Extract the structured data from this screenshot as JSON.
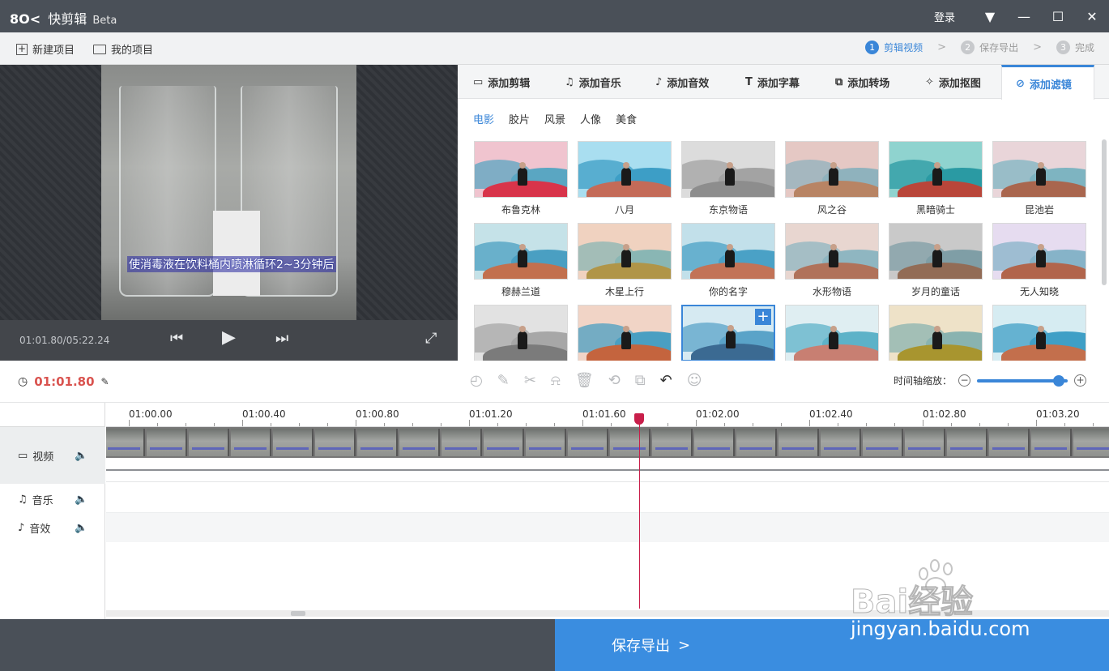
{
  "titlebar": {
    "logo": "快剪辑",
    "beta": "Beta",
    "login": "登录"
  },
  "toolbar": {
    "new_project": "新建项目",
    "my_projects": "我的项目",
    "steps": [
      {
        "num": "1",
        "label": "剪辑视频",
        "active": true
      },
      {
        "num": "2",
        "label": "保存导出",
        "active": false
      },
      {
        "num": "3",
        "label": "完成",
        "active": false
      }
    ]
  },
  "preview": {
    "subtitle": "使消毒液在饮料桶内喷淋循环2~3分钟后",
    "timecode": "01:01.80/05:22.24"
  },
  "panel": {
    "tabs": [
      {
        "label": "添加剪辑",
        "icon": "video-icon"
      },
      {
        "label": "添加音乐",
        "icon": "music-icon"
      },
      {
        "label": "添加音效",
        "icon": "sound-effect-icon"
      },
      {
        "label": "添加字幕",
        "icon": "text-icon"
      },
      {
        "label": "添加转场",
        "icon": "transition-icon"
      },
      {
        "label": "添加抠图",
        "icon": "cutout-icon"
      },
      {
        "label": "添加滤镜",
        "icon": "filter-icon",
        "active": true
      }
    ],
    "categories": [
      {
        "label": "电影",
        "active": true
      },
      {
        "label": "胶片",
        "active": false
      },
      {
        "label": "风景",
        "active": false
      },
      {
        "label": "人像",
        "active": false
      },
      {
        "label": "美食",
        "active": false
      }
    ],
    "filters": [
      {
        "label": "布鲁克林",
        "sky": "#f0c4cf",
        "rock": "#d8344a",
        "mtn": "#5aa6c2"
      },
      {
        "label": "八月",
        "sky": "#a9def0",
        "rock": "#c46b58",
        "mtn": "#3d9ec6"
      },
      {
        "label": "东京物语",
        "sky": "#dcdcdc",
        "rock": "#8d8d8d",
        "mtn": "#a3a3a3"
      },
      {
        "label": "风之谷",
        "sky": "#e5c8c4",
        "rock": "#b88464",
        "mtn": "#8fb2bd"
      },
      {
        "label": "黑暗骑士",
        "sky": "#8fd3cf",
        "rock": "#b9463a",
        "mtn": "#2a9aa3"
      },
      {
        "label": "昆池岩",
        "sky": "#e9d5d9",
        "rock": "#a9664e",
        "mtn": "#7eb4c1"
      },
      {
        "label": "穆赫兰道",
        "sky": "#c5e2e8",
        "rock": "#c2704e",
        "mtn": "#4a9fc2"
      },
      {
        "label": "木星上行",
        "sky": "#f0d2c0",
        "rock": "#b09548",
        "mtn": "#89b6b4"
      },
      {
        "label": "你的名字",
        "sky": "#c2e0ea",
        "rock": "#c27357",
        "mtn": "#4aa1c6"
      },
      {
        "label": "水形物语",
        "sky": "#e8d6d0",
        "rock": "#b0725a",
        "mtn": "#8fb6c1"
      },
      {
        "label": "岁月的童话",
        "sky": "#c9c9c9",
        "rock": "#926c56",
        "mtn": "#7f9ea6"
      },
      {
        "label": "无人知晓",
        "sky": "#e6dcf0",
        "rock": "#b1654c",
        "mtn": "#86b3c8"
      },
      {
        "label": "",
        "sky": "#e2e2e2",
        "rock": "#7b7b7b",
        "mtn": "#a7a7a7"
      },
      {
        "label": "",
        "sky": "#f1d4c6",
        "rock": "#c4643e",
        "mtn": "#4a9fc2"
      },
      {
        "label": "",
        "sky": "#d6eaf2",
        "rock": "#3b6a92",
        "mtn": "#5aa3c8",
        "selected": true
      },
      {
        "label": "",
        "sky": "#dfeef2",
        "rock": "#c87f72",
        "mtn": "#5db2c8"
      },
      {
        "label": "",
        "sky": "#eee2c8",
        "rock": "#a8952f",
        "mtn": "#89b3b0"
      },
      {
        "label": "",
        "sky": "#d6ecf2",
        "rock": "#c36f4c",
        "mtn": "#3f9fc6"
      }
    ]
  },
  "editbar": {
    "current_time": "01:01.80",
    "zoom_label": "时间轴缩放：",
    "zoom_level": 0.9
  },
  "timeline": {
    "ticks": [
      "01:00.00",
      "01:00.40",
      "01:00.80",
      "01:01.20",
      "01:01.60",
      "01:02.00",
      "01:02.40",
      "01:02.80",
      "01:03.20"
    ],
    "tracks": {
      "video": "视频",
      "music": "音乐",
      "sfx": "音效"
    }
  },
  "footer": {
    "export": "保存导出"
  },
  "watermark": {
    "brand": "Bai经验",
    "url": "jingyan.baidu.com"
  },
  "colors": {
    "accent": "#3a86d8",
    "playhead": "#c81e4a",
    "titlebar": "#4a5058"
  }
}
